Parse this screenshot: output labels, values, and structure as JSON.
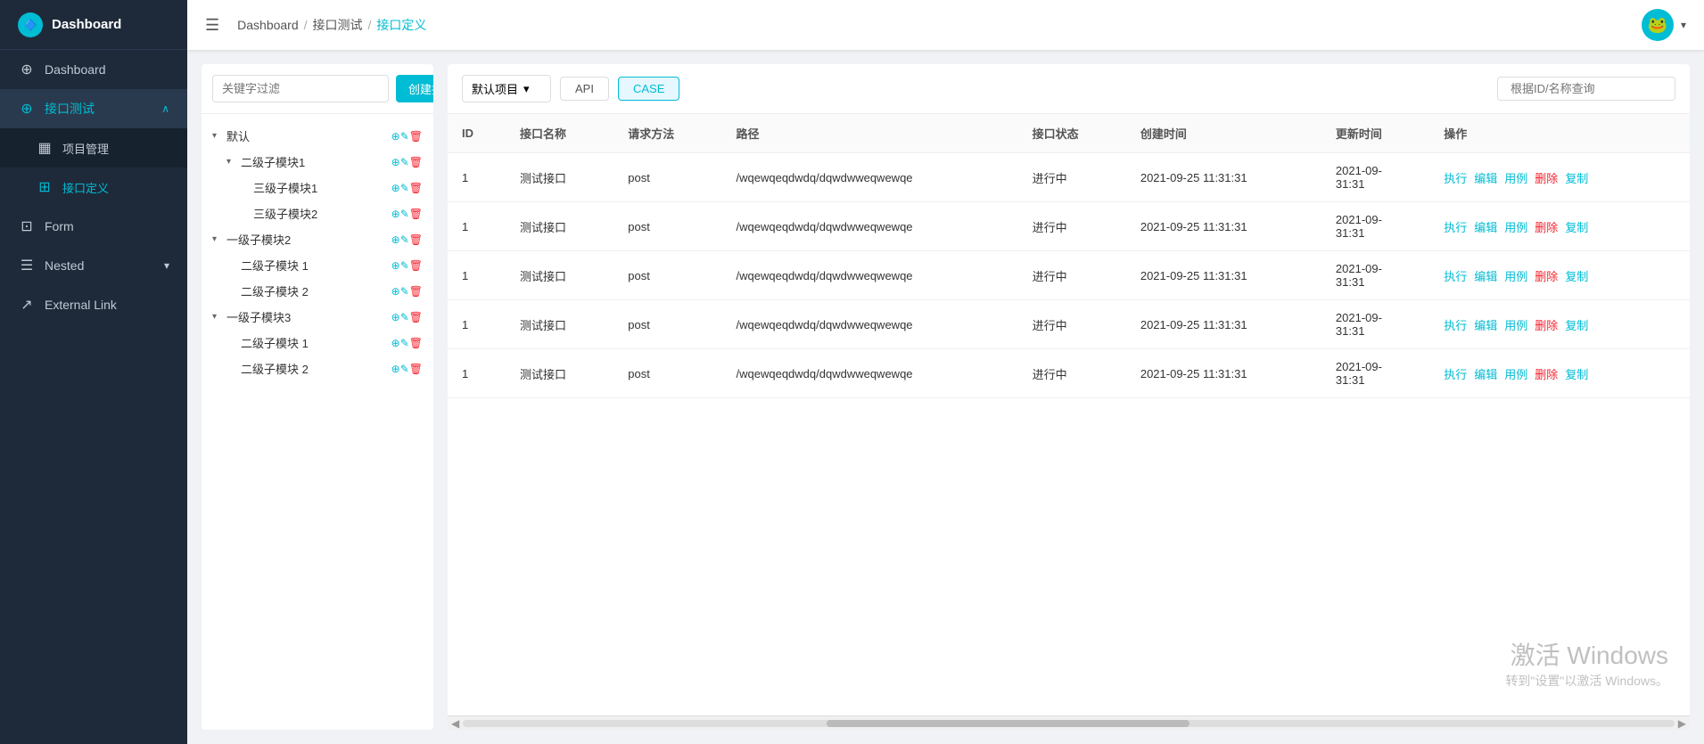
{
  "sidebar": {
    "logo": {
      "icon": "🔷",
      "text": "Dashboard"
    },
    "items": [
      {
        "id": "dashboard",
        "label": "Dashboard",
        "icon": "⊕",
        "active": false
      },
      {
        "id": "interface-test",
        "label": "接口测试",
        "icon": "⊕",
        "active": true,
        "expanded": true
      },
      {
        "id": "project-manage",
        "label": "项目管理",
        "icon": "▦",
        "active": false
      },
      {
        "id": "interface-def",
        "label": "接口定义",
        "icon": "⊞",
        "active": true
      },
      {
        "id": "form",
        "label": "Form",
        "icon": "⊡",
        "active": false
      },
      {
        "id": "nested",
        "label": "Nested",
        "icon": "☰",
        "active": false,
        "arrow": "▾"
      },
      {
        "id": "external-link",
        "label": "External Link",
        "icon": "↗",
        "active": false
      }
    ]
  },
  "header": {
    "menu_icon": "☰",
    "breadcrumb": [
      {
        "label": "Dashboard",
        "active": false
      },
      {
        "label": "接口测试",
        "active": false
      },
      {
        "label": "接口定义",
        "active": true
      }
    ],
    "avatar_icon": "🐸"
  },
  "left_panel": {
    "search_placeholder": "关键字过滤",
    "create_btn": "创建接口",
    "tree": {
      "root": {
        "label": "默认",
        "actions": [
          "copy",
          "edit",
          "delete"
        ],
        "children": [
          {
            "label": "二级子模块1",
            "actions": [
              "copy",
              "edit",
              "delete"
            ],
            "children": [
              {
                "label": "三级子模块1",
                "actions": [
                  "copy",
                  "edit",
                  "delete"
                ]
              },
              {
                "label": "三级子模块2",
                "actions": [
                  "copy",
                  "edit",
                  "delete"
                ]
              }
            ]
          }
        ]
      },
      "nodes": [
        {
          "label": "一级子模块2",
          "actions": [
            "copy",
            "edit",
            "delete"
          ],
          "children": [
            {
              "label": "二级子模块 1",
              "actions": [
                "copy",
                "edit",
                "delete"
              ]
            },
            {
              "label": "二级子模块 2",
              "actions": [
                "copy",
                "edit",
                "delete"
              ]
            }
          ]
        },
        {
          "label": "一级子模块3",
          "actions": [
            "copy",
            "edit",
            "delete"
          ],
          "children": [
            {
              "label": "二级子模块 1",
              "actions": [
                "copy",
                "edit",
                "delete"
              ]
            },
            {
              "label": "二级子模块 2",
              "actions": [
                "copy",
                "edit",
                "delete"
              ]
            }
          ]
        }
      ]
    }
  },
  "right_panel": {
    "project_select": {
      "label": "默认项目",
      "arrow": "▾"
    },
    "tabs": [
      {
        "id": "api",
        "label": "API",
        "active": false
      },
      {
        "id": "case",
        "label": "CASE",
        "active": true
      }
    ],
    "search_placeholder": "根据ID/名称查询",
    "table": {
      "columns": [
        "ID",
        "接口名称",
        "请求方法",
        "路径",
        "接口状态",
        "创建时间",
        "更新时间",
        "操作"
      ],
      "rows": [
        {
          "id": "1",
          "name": "测试接口",
          "method": "post",
          "path": "/wqewqeqdwdq/dqwdwweqwewqe",
          "status": "进行中",
          "created": "2021-09-25 11:31:31",
          "updated": "2021-09-",
          "actions": [
            "执行",
            "编辑",
            "用例",
            "删除",
            "复制"
          ]
        },
        {
          "id": "1",
          "name": "测试接口",
          "method": "post",
          "path": "/wqewqeqdwdq/dqwdwweqwewqe",
          "status": "进行中",
          "created": "2021-09-25 11:31:31",
          "updated": "2021-09-",
          "actions": [
            "执行",
            "编辑",
            "用例",
            "删除",
            "复制"
          ]
        },
        {
          "id": "1",
          "name": "测试接口",
          "method": "post",
          "path": "/wqewqeqdwdq/dqwdwweqwewqe",
          "status": "进行中",
          "created": "2021-09-25 11:31:31",
          "updated": "2021-09-",
          "actions": [
            "执行",
            "编辑",
            "用例",
            "删除",
            "复制"
          ]
        },
        {
          "id": "1",
          "name": "测试接口",
          "method": "post",
          "path": "/wqewqeqdwdq/dqwdwweqwewqe",
          "status": "进行中",
          "created": "2021-09-25 11:31:31",
          "updated": "2021-09-",
          "actions": [
            "执行",
            "编辑",
            "用例",
            "删除",
            "复制"
          ]
        },
        {
          "id": "1",
          "name": "测试接口",
          "method": "post",
          "path": "/wqewqeqdwdq/dqwdwweqwewqe",
          "status": "进行中",
          "created": "2021-09-25 11:31:31",
          "updated": "2021-09-",
          "actions": [
            "执行",
            "编辑",
            "用例",
            "删除",
            "复制"
          ]
        }
      ]
    }
  },
  "windows_watermark": {
    "line1": "激活 Windows",
    "line2": "转到\"设置\"以激活 Windows。"
  }
}
